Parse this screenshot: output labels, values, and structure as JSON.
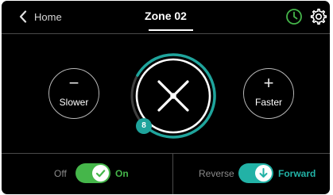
{
  "header": {
    "back_label": "Home",
    "title": "Zone 02"
  },
  "icons": {
    "back": "chevron-left-icon",
    "schedule": "clock-icon",
    "settings": "gear-icon",
    "fan": "fan-icon",
    "power_on": "check-icon",
    "direction_forward": "arrow-down-icon"
  },
  "controls": {
    "slower_symbol": "−",
    "slower_label": "Slower",
    "faster_symbol": "+",
    "faster_label": "Faster",
    "speed_level": "8"
  },
  "power": {
    "off_label": "Off",
    "on_label": "On",
    "state": "on"
  },
  "direction": {
    "reverse_label": "Reverse",
    "forward_label": "Forward",
    "state": "forward"
  },
  "colors": {
    "background": "#000000",
    "accent_teal": "#1fa49c",
    "accent_green": "#45b64a",
    "text": "#ffffff",
    "muted": "#8a8a8a"
  }
}
